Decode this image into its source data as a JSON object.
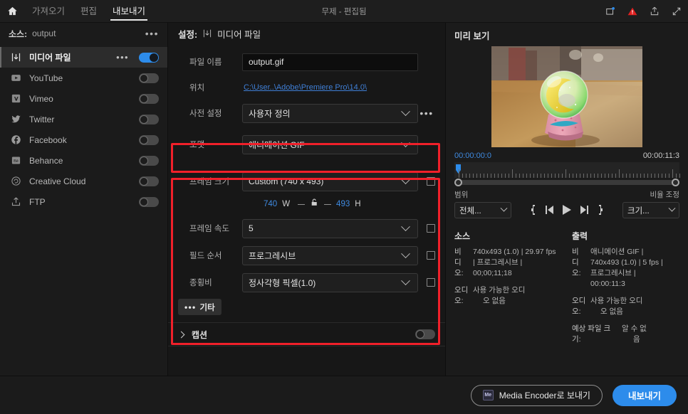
{
  "titlebar": {
    "home_icon": "home-icon",
    "tabs": [
      {
        "label": "가져오기",
        "active": false
      },
      {
        "label": "편집",
        "active": false
      },
      {
        "label": "내보내기",
        "active": true
      }
    ],
    "window_title": "무제 - 편집됨",
    "icons": [
      "notification-icon",
      "warning-icon",
      "share-icon",
      "fullscreen-icon"
    ]
  },
  "sidebar": {
    "source_label": "소스:",
    "source_value": "output",
    "menu_dots": "•••",
    "items": [
      {
        "label": "미디어 파일",
        "icon": "media-file-icon",
        "toggle": "on",
        "selected": true,
        "dots": "•••"
      },
      {
        "label": "YouTube",
        "icon": "youtube-icon",
        "toggle": "off",
        "selected": false
      },
      {
        "label": "Vimeo",
        "icon": "vimeo-icon",
        "toggle": "off",
        "selected": false
      },
      {
        "label": "Twitter",
        "icon": "twitter-icon",
        "toggle": "off",
        "selected": false
      },
      {
        "label": "Facebook",
        "icon": "facebook-icon",
        "toggle": "off",
        "selected": false
      },
      {
        "label": "Behance",
        "icon": "behance-icon",
        "toggle": "off",
        "selected": false
      },
      {
        "label": "Creative Cloud",
        "icon": "creative-cloud-icon",
        "toggle": "off",
        "selected": false
      },
      {
        "label": "FTP",
        "icon": "ftp-icon",
        "toggle": "off",
        "selected": false
      }
    ]
  },
  "settings": {
    "header_label": "설정:",
    "header_value": "미디어 파일",
    "filename": {
      "label": "파일 이름",
      "value": "output.gif"
    },
    "location": {
      "label": "위치",
      "value": "C:\\User..\\Adobe\\Premiere Pro\\14.0\\"
    },
    "preset": {
      "label": "사전 설정",
      "value": "사용자 정의",
      "dots": "•••"
    },
    "format": {
      "label": "포맷",
      "value": "애니메이션 GIF"
    },
    "frame_size": {
      "label": "프레임 크기",
      "value": "Custom (740 x 493)"
    },
    "dimensions": {
      "width": "740",
      "width_unit": "W",
      "height": "493",
      "height_unit": "H"
    },
    "frame_rate": {
      "label": "프레임 속도",
      "value": "5"
    },
    "field_order": {
      "label": "필드 순서",
      "value": "프로그레시브"
    },
    "aspect": {
      "label": "종횡비",
      "value": "정사각형 픽셀(1.0)"
    },
    "more_button": {
      "label": "기타",
      "dots": "•••"
    },
    "caption": {
      "label": "캡션",
      "toggle": "off"
    }
  },
  "preview": {
    "title": "미리 보기",
    "timecode_in": "00:00:00:0",
    "timecode_out": "00:00:11:3",
    "range_label": "범위",
    "range_value": "전체...",
    "scale_label": "비율 조정",
    "scale_value": "크기...",
    "transport": [
      "in-point-icon",
      "step-back-icon",
      "play-icon",
      "step-forward-icon",
      "out-point-icon"
    ]
  },
  "info": {
    "source": {
      "title": "소스",
      "rows": [
        {
          "key": "비",
          "value": "740x493 (1.0)  |  29.97 fps"
        },
        {
          "key": "디",
          "value": "|  프로그레시브  |"
        },
        {
          "key": "오:",
          "value": "00;00;11;18"
        }
      ],
      "audio": {
        "key": "오디",
        "key2": "오:",
        "value": "사용 가능한 오디",
        "value2": "오 없음"
      }
    },
    "output": {
      "title": "출력",
      "rows": [
        {
          "key": "비",
          "value": "애니메이션 GIF  |"
        },
        {
          "key": "디",
          "value": "740x493 (1.0)  |  5 fps  |"
        },
        {
          "key": "오:",
          "value": "프로그레시브  |"
        }
      ],
      "duration": "00:00:11:3",
      "audio": {
        "key": "오디",
        "key2": "오:",
        "value": "사용 가능한 오디",
        "value2": "오 없음"
      },
      "filesize": {
        "label": "예상 파일 크",
        "label2": "기:",
        "value": "알 수 없",
        "value2": "음"
      }
    }
  },
  "footer": {
    "media_encoder_button": "Media Encoder로 보내기",
    "media_encoder_badge": "Me",
    "export_button": "내보내기"
  },
  "colors": {
    "accent_blue": "#2d8ceb",
    "link_blue": "#3f7fd6",
    "highlight_red": "#f0202a",
    "warning_red": "#e02020"
  }
}
